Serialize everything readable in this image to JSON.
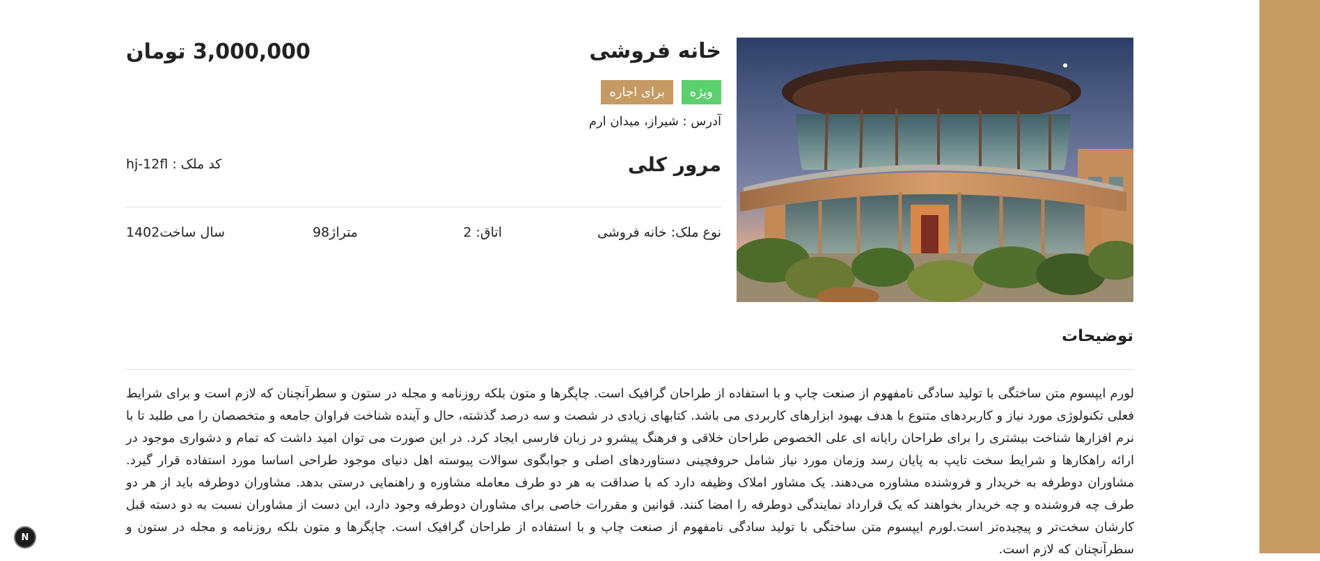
{
  "listing": {
    "title": "خانه فروشی",
    "price": "3,000,000 تومان",
    "badges": {
      "featured": "ویژه",
      "rent": "برای اجاره"
    },
    "address": "آدرس : شیراز، میدان ارم",
    "photo_icon": "house-photo"
  },
  "overview": {
    "title": "مرور کلی",
    "property_code": "کد ملک : hj-12fl",
    "stats": {
      "type": "نوع ملک: خانه فروشی",
      "rooms": "اتاق: 2",
      "area": "متراژ98",
      "year": "سال ساخت1402"
    }
  },
  "description": {
    "title": "توضیحات",
    "text": "لورم ایپسوم متن ساختگی با تولید سادگی نامفهوم از صنعت چاپ و با استفاده از طراحان گرافیک است. چاپگرها و متون بلکه روزنامه و مجله در ستون و سطرآنچنان که لازم است و برای شرایط فعلی تکنولوژی مورد نیاز و کاربردهای متنوع با هدف بهبود ابزارهای کاربردی می باشد. کتابهای زیادی در شصت و سه درصد گذشته، حال و آینده شناخت فراوان جامعه و متخصصان را می طلبد تا با نرم افزارها شناخت بیشتری را برای طراحان رایانه ای علی الخصوص طراحان خلاقی و فرهنگ پیشرو در زبان فارسی ایجاد کرد. در این صورت می توان امید داشت که تمام و دشواری موجود در ارائه راهکارها و شرایط سخت تایپ به پایان رسد وزمان مورد نیاز شامل حروفچینی دستاوردهای اصلی و جوابگوی سوالات پیوسته اهل دنیای موجود طراحی اساسا مورد استفاده قرار گیرد. مشاوران دوطرفه به خریدار و فروشنده مشاوره می‌دهند. یک مشاور املاک وظیفه دارد که با صداقت به هر دو طرف معامله مشاوره و راهنمایی درستی بدهد. مشاوران دوطرفه باید از هر دو طرف چه فروشنده و چه خریدار بخواهند که یک قرارداد نمایندگی دوطرفه را امضا کنند. قوانین و مقررات خاصی برای مشاوران دوطرفه وجود دارد، این دست از مشاوران نسبت به دو دسته قبل کارشان سخت‌تر و پیچیده‌تر است.لورم ایپسوم متن ساختگی با تولید سادگی نامفهوم از صنعت چاپ و با استفاده از طراحان گرافیک است. چاپگرها و متون بلکه روزنامه و مجله در ستون و سطرآنچنان که لازم است."
  },
  "overlay": {
    "badge_letter": "N"
  },
  "colors": {
    "accent": "#c69a63",
    "featured": "#5ccf6e",
    "divider": "#dedede",
    "text": "#222222"
  }
}
